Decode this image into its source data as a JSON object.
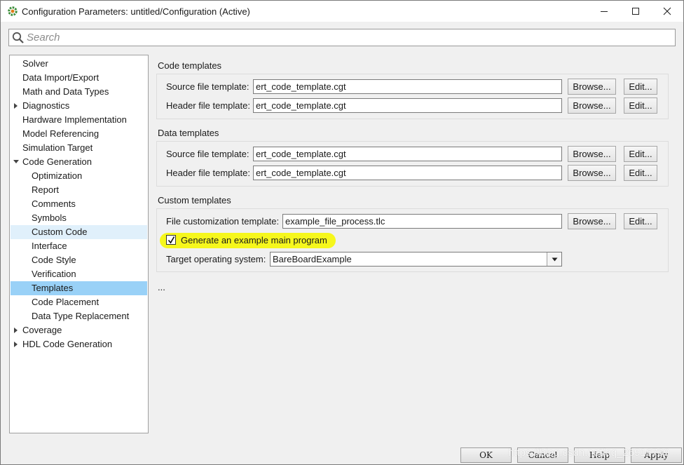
{
  "window": {
    "title": "Configuration Parameters: untitled/Configuration (Active)",
    "app_icon": "simulink-gear-icon"
  },
  "search": {
    "placeholder": "Search",
    "value": ""
  },
  "tree": {
    "items": [
      {
        "label": "Solver",
        "level": 0,
        "arrow": "none",
        "state": "normal"
      },
      {
        "label": "Data Import/Export",
        "level": 0,
        "arrow": "none",
        "state": "normal"
      },
      {
        "label": "Math and Data Types",
        "level": 0,
        "arrow": "none",
        "state": "normal"
      },
      {
        "label": "Diagnostics",
        "level": 0,
        "arrow": "collapsed",
        "state": "normal"
      },
      {
        "label": "Hardware Implementation",
        "level": 0,
        "arrow": "none",
        "state": "normal"
      },
      {
        "label": "Model Referencing",
        "level": 0,
        "arrow": "none",
        "state": "normal"
      },
      {
        "label": "Simulation Target",
        "level": 0,
        "arrow": "none",
        "state": "normal"
      },
      {
        "label": "Code Generation",
        "level": 0,
        "arrow": "expanded",
        "state": "normal"
      },
      {
        "label": "Optimization",
        "level": 1,
        "arrow": "none",
        "state": "normal"
      },
      {
        "label": "Report",
        "level": 1,
        "arrow": "none",
        "state": "normal"
      },
      {
        "label": "Comments",
        "level": 1,
        "arrow": "none",
        "state": "normal"
      },
      {
        "label": "Symbols",
        "level": 1,
        "arrow": "none",
        "state": "normal"
      },
      {
        "label": "Custom Code",
        "level": 1,
        "arrow": "none",
        "state": "hover"
      },
      {
        "label": "Interface",
        "level": 1,
        "arrow": "none",
        "state": "normal"
      },
      {
        "label": "Code Style",
        "level": 1,
        "arrow": "none",
        "state": "normal"
      },
      {
        "label": "Verification",
        "level": 1,
        "arrow": "none",
        "state": "normal"
      },
      {
        "label": "Templates",
        "level": 1,
        "arrow": "none",
        "state": "selected"
      },
      {
        "label": "Code Placement",
        "level": 1,
        "arrow": "none",
        "state": "normal"
      },
      {
        "label": "Data Type Replacement",
        "level": 1,
        "arrow": "none",
        "state": "normal"
      },
      {
        "label": "Coverage",
        "level": 0,
        "arrow": "collapsed",
        "state": "normal"
      },
      {
        "label": "HDL Code Generation",
        "level": 0,
        "arrow": "collapsed",
        "state": "normal"
      }
    ]
  },
  "code_templates": {
    "title": "Code templates",
    "source_label": "Source file template:",
    "source_value": "ert_code_template.cgt",
    "header_label": "Header file template:",
    "header_value": "ert_code_template.cgt"
  },
  "data_templates": {
    "title": "Data templates",
    "source_label": "Source file template:",
    "source_value": "ert_code_template.cgt",
    "header_label": "Header file template:",
    "header_value": "ert_code_template.cgt"
  },
  "custom_templates": {
    "title": "Custom templates",
    "file_label": "File customization template:",
    "file_value": "example_file_process.tlc",
    "generate_main_label": "Generate an example main program",
    "generate_main_checked": true,
    "target_os_label": "Target operating system:",
    "target_os_value": "BareBoardExample"
  },
  "buttons": {
    "browse": "Browse...",
    "edit": "Edit..."
  },
  "ellipsis": "...",
  "footer": {
    "ok": "OK",
    "cancel": "Cancel",
    "help": "Help",
    "apply": "Apply"
  },
  "watermark": "https://blog.csdn.net/qq_26916769",
  "colors": {
    "selected": "#99d1f7",
    "hover": "#e0f0fb",
    "highlight": "#f6f71c"
  }
}
